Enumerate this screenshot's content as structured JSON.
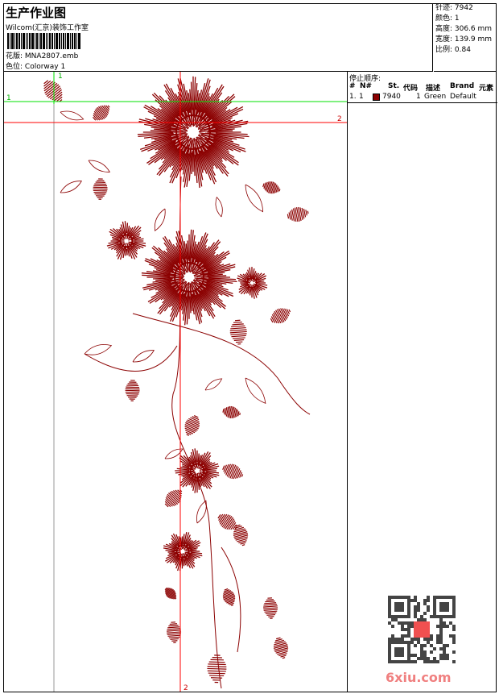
{
  "header": {
    "title": "生产作业图",
    "company": "Wilcom(汇京)装饰工作室",
    "design_label": "花版:",
    "design_value": "MNA2807.emb",
    "colorway_label": "色位:",
    "colorway_value": "Colorway 1"
  },
  "info": {
    "stitches": "针迹: 7942",
    "colors": "颜色: 1",
    "height": "高度: 306.6 mm",
    "width": "宽度: 139.9 mm",
    "scale": "比例: 0.84"
  },
  "stop_sequence": {
    "heading": "停止顺序:",
    "columns": [
      "#",
      "N#",
      "St.",
      "代码",
      "描述",
      "Brand",
      "元素"
    ],
    "rows": [
      {
        "index": "1.",
        "n": "1",
        "color": "#8b0000",
        "stitches": "7940",
        "code": "1",
        "description": "Green",
        "brand": "Default"
      }
    ]
  },
  "guides": {
    "green_v": "1",
    "green_h": "1",
    "red_h": "2",
    "red_v": "2"
  },
  "colors": {
    "thread": "#8b0000",
    "green_guide": "#00e000",
    "red_guide": "#ff0000"
  },
  "watermark": "6xiu.com"
}
